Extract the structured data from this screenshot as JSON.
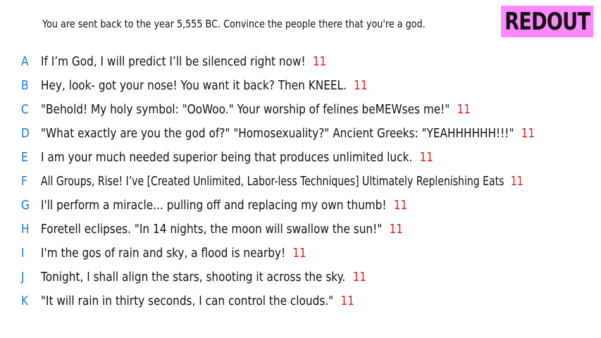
{
  "prompt": "You are sent back to the year 5,555 BC. Convince the people there that you're a god.",
  "logo": "REDOUT",
  "colors": {
    "letter": "#1a74e8",
    "score": "#e51c1c",
    "logo_bg": "#ff88ff"
  },
  "answers": [
    {
      "letter": "A",
      "text": "If I’m God, I will predict I’ll be silenced right now!",
      "score": "11"
    },
    {
      "letter": "B",
      "text": "Hey, look- got your nose! You want it back? Then KNEEL.",
      "score": "11"
    },
    {
      "letter": "C",
      "text": "\"Behold! My holy symbol: \"OoWoo.\" Your worship of felines beMEWses me!\"",
      "score": "11"
    },
    {
      "letter": "D",
      "text": "\"What exactly are you the god of?\" \"Homosexuality?\" Ancient Greeks: \"YEAHHHHHH!!!\"",
      "score": "11"
    },
    {
      "letter": "E",
      "text": "I am your much needed superior being that produces unlimited luck.",
      "score": "11"
    },
    {
      "letter": "F",
      "text": "All Groups, Rise! I’ve [Created Unlimited, Labor-less Techniques] Ultimately Replenishing Eats",
      "score": "11"
    },
    {
      "letter": "G",
      "text": "I'll perform a miracle... pulling off and replacing my own thumb!",
      "score": "11"
    },
    {
      "letter": "H",
      "text": "Foretell eclipses. \"In 14 nights, the moon will swallow the sun!\"",
      "score": "11"
    },
    {
      "letter": "I",
      "text": "I'm the gos of rain and sky, a flood is nearby!",
      "score": "11"
    },
    {
      "letter": "J",
      "text": "Tonight, I shall align the stars, shooting it across the sky.",
      "score": "11"
    },
    {
      "letter": "K",
      "text": "\"It will rain in thirty seconds, I can control the clouds.\"",
      "score": "11"
    }
  ]
}
